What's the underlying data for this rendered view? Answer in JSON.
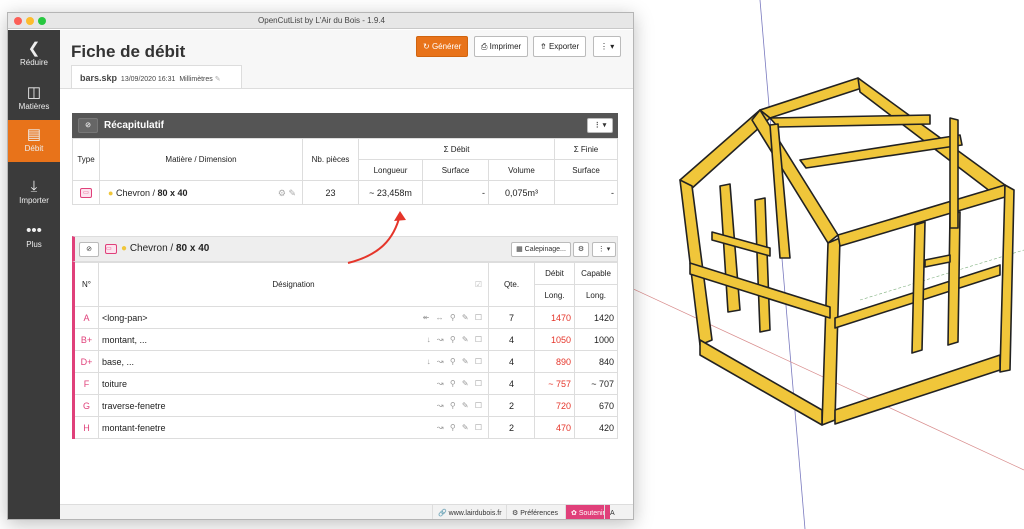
{
  "window": {
    "title": "OpenCutList by L'Air du Bois - 1.9.4"
  },
  "sidebar": {
    "items": [
      {
        "label": "Réduire",
        "icon": "chevron-left-icon"
      },
      {
        "label": "Matières",
        "icon": "material-icon"
      },
      {
        "label": "Débit",
        "icon": "cutlist-icon"
      },
      {
        "label": "Importer",
        "icon": "import-icon"
      },
      {
        "label": "Plus",
        "icon": "more-icon"
      }
    ]
  },
  "header": {
    "title": "Fiche de débit",
    "generate": "Générer",
    "print": "Imprimer",
    "export": "Exporter"
  },
  "tab": {
    "file": "bars.skp",
    "date": "13/09/2020 16:31",
    "unit": "Millimètres"
  },
  "summary": {
    "title": "Récapitulatif",
    "headers": {
      "type": "Type",
      "material": "Matière / Dimension",
      "count": "Nb. pièces",
      "debit": "Σ Débit",
      "finie": "Σ Finie",
      "length": "Longueur",
      "surface": "Surface",
      "volume": "Volume",
      "surface2": "Surface"
    },
    "row": {
      "material": "Chevron / ",
      "dimension": "80 x 40",
      "count": "23",
      "length": "~ 23,458m",
      "surface": "-",
      "volume": "0,075m³",
      "finished_surface": "-"
    }
  },
  "group": {
    "material": "Chevron / ",
    "dimension": "80 x 40",
    "calepinage": "Calepinage...",
    "headers": {
      "num": "N°",
      "designation": "Désignation",
      "qty": "Qte.",
      "debit": "Débit",
      "capable": "Capable",
      "long1": "Long.",
      "long2": "Long."
    },
    "rows": [
      {
        "id": "A",
        "name": "<long-pan>",
        "qty": "7",
        "debit": "1470",
        "capable": "1420"
      },
      {
        "id": "B+",
        "name": "montant, ...",
        "qty": "4",
        "debit": "1050",
        "capable": "1000"
      },
      {
        "id": "D+",
        "name": "base, ...",
        "qty": "4",
        "debit": "890",
        "capable": "840"
      },
      {
        "id": "F",
        "name": "toiture",
        "qty": "4",
        "debit": "~ 757",
        "capable": "~ 707"
      },
      {
        "id": "G",
        "name": "traverse-fenetre",
        "qty": "2",
        "debit": "720",
        "capable": "670"
      },
      {
        "id": "H",
        "name": "montant-fenetre",
        "qty": "2",
        "debit": "470",
        "capable": "420"
      }
    ]
  },
  "footer": {
    "site": "www.lairdubois.fr",
    "prefs": "Préférences",
    "support": "Soutenir",
    "about": "A propos"
  },
  "colors": {
    "accent": "#e8731a",
    "sidebar": "#3b3b3b",
    "pink": "#e0407a",
    "red": "#e5352a",
    "wood": "#f0c63a"
  }
}
